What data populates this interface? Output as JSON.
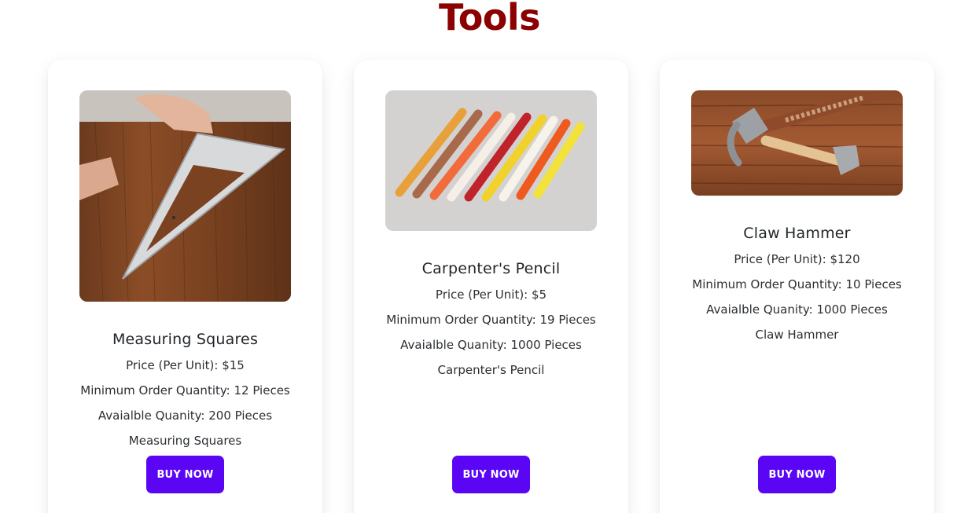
{
  "page": {
    "title": "Tools"
  },
  "products": [
    {
      "name": "Measuring Squares",
      "price": "Price (Per Unit): $15",
      "min_order": "Minimum Order Quantity: 12 Pieces",
      "available": "Avaialble Quanity: 200 Pieces",
      "description": "Measuring Squares",
      "button": "BUY NOW",
      "image_alt": "speed square on wood"
    },
    {
      "name": "Carpenter's Pencil",
      "price": "Price (Per Unit): $5",
      "min_order": "Minimum Order Quantity: 19 Pieces",
      "available": "Avaialble Quanity: 1000 Pieces",
      "description": "Carpenter's Pencil",
      "button": "BUY NOW",
      "image_alt": "carpenter pencils"
    },
    {
      "name": "Claw Hammer",
      "price": "Price (Per Unit): $120",
      "min_order": "Minimum Order Quantity: 10 Pieces",
      "available": "Avaialble Quanity: 1000 Pieces",
      "description": "Claw Hammer",
      "button": "BUY NOW",
      "image_alt": "claw hammers on wood"
    }
  ],
  "colors": {
    "title": "#8b0000",
    "button": "#5a06f5",
    "button_text": "#ffffff"
  }
}
